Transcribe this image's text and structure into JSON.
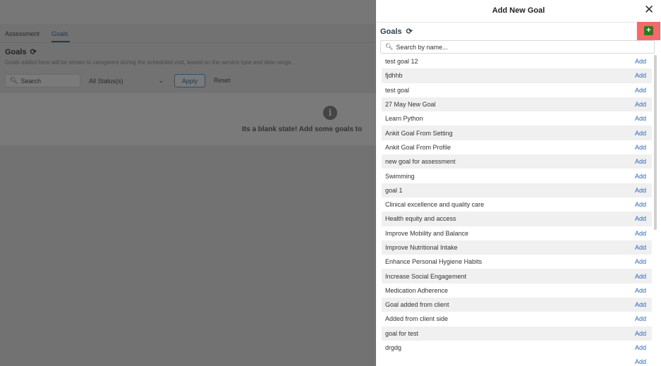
{
  "background": {
    "tabs": [
      "Assessment",
      "Goals"
    ],
    "title": "Goals",
    "description": "Goals added here will be shown to caregivers during the scheduled visit, based on the service type and date range.",
    "search_placeholder": "Search",
    "status_select": "All Status(s)",
    "apply_label": "Apply",
    "reset_label": "Reset",
    "empty_text": "Its a blank state! Add some goals to"
  },
  "panel": {
    "title": "Add New Goal",
    "goals_label": "Goals",
    "search_placeholder": "Search by name...",
    "add_label": "Add",
    "goals": [
      "test goal 12",
      "fjdhhb",
      "test goal",
      "27 May New Goal",
      "Learn Python",
      "Ankit Goal From Setting",
      "Ankit Goal From Profile",
      "new goal for assessment",
      "Swimming",
      "goal 1",
      "Clinical excellence and quality care",
      "Health equity and access",
      "Improve Mobility and Balance",
      "Improve Nutritional Intake",
      "Enhance Personal Hygiene Habits",
      "Increase Social Engagement",
      "Medication Adherence",
      "Goal added from client",
      "Added from client side",
      "goal for test",
      "drgdg"
    ]
  },
  "colors": {
    "accent": "#2f66b3",
    "add_button": "#2f7a1f",
    "highlight": "#f26b6b"
  }
}
